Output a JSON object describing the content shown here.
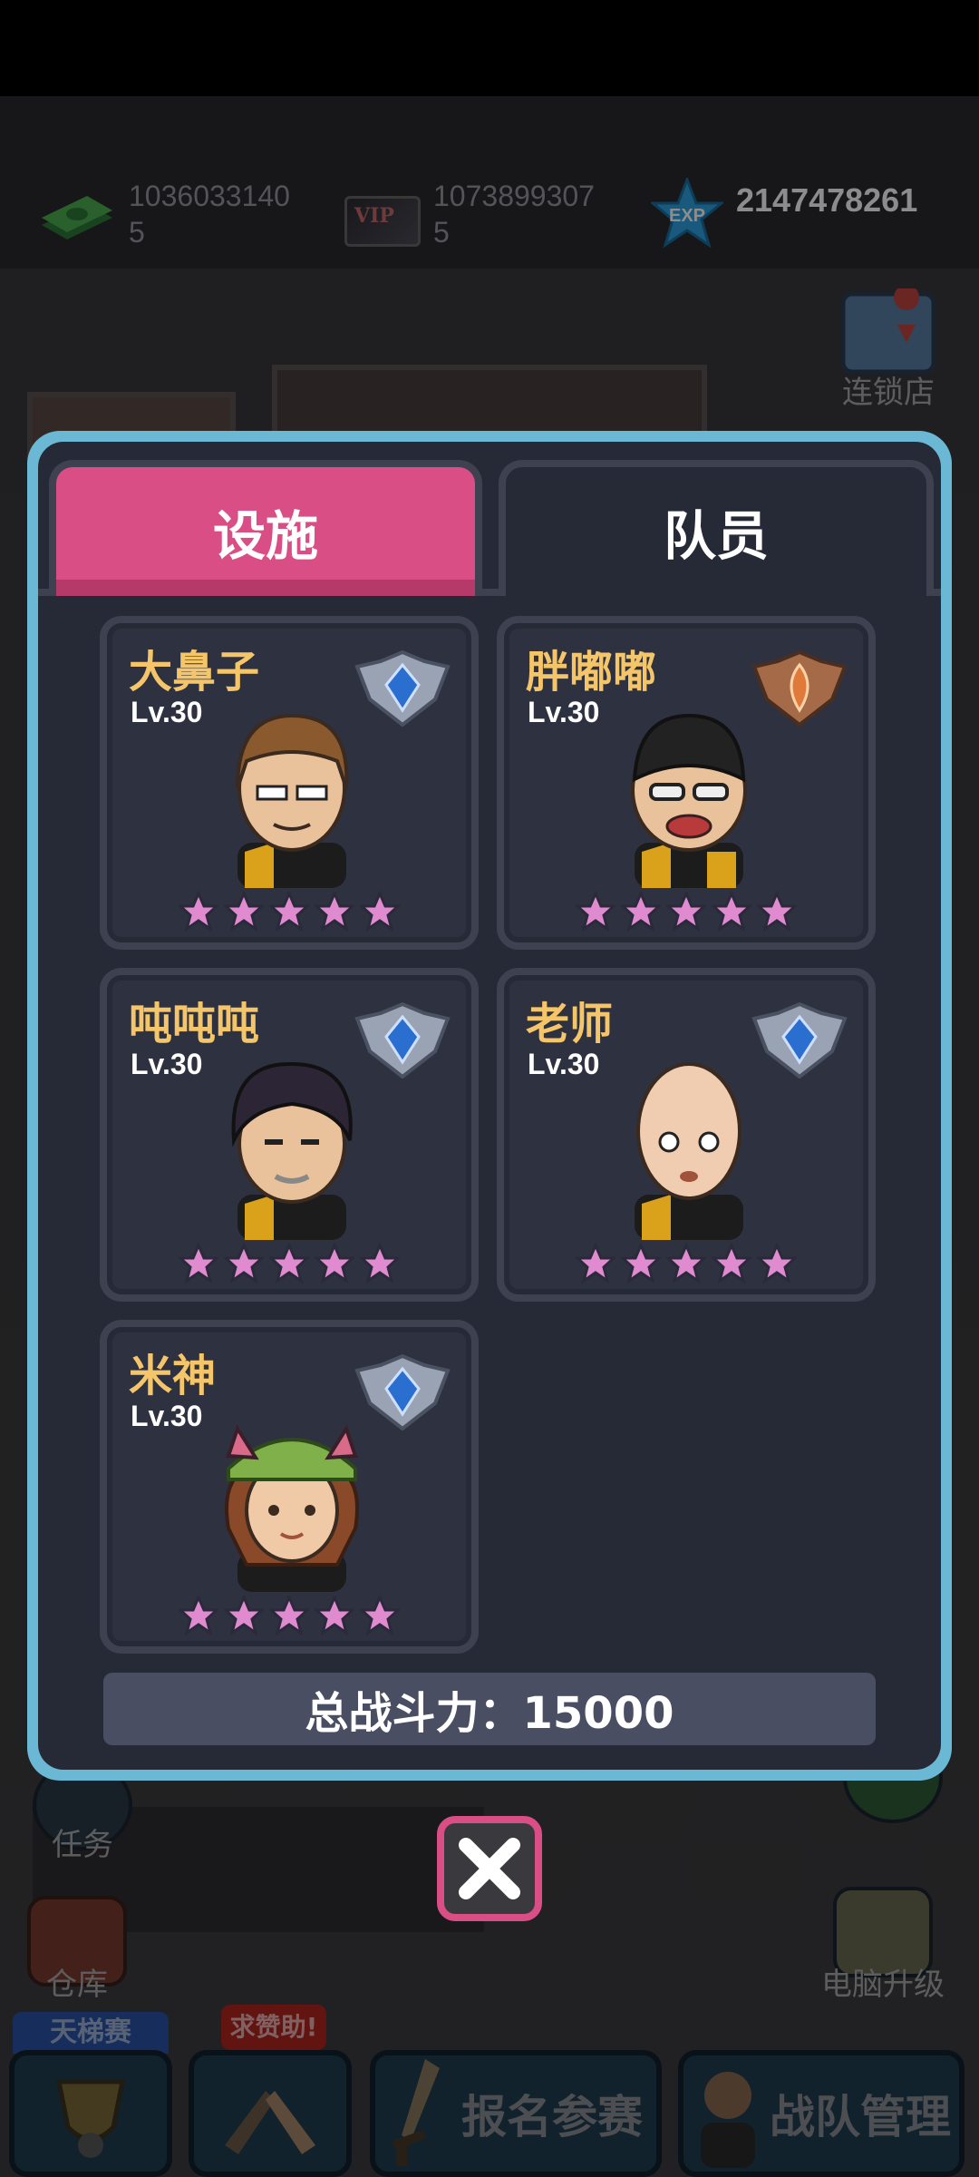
{
  "resources": {
    "cash": "1036033140 5",
    "vip": "1073899307 5",
    "vip_label": "VIP",
    "exp": "2147478261",
    "exp_label": "EXP"
  },
  "background": {
    "chain_store": "连锁店",
    "tasks": "任务",
    "warehouse": "仓库",
    "pc_upgrade": "电脑升级"
  },
  "bottom_nav": {
    "ladder": "天梯赛",
    "help": "求赞助!",
    "signup": "报名参赛",
    "team_manage": "战队管理"
  },
  "modal": {
    "tabs": [
      {
        "label": "设施",
        "active": false
      },
      {
        "label": "队员",
        "active": true
      }
    ],
    "members": [
      {
        "name": "大鼻子",
        "level": "Lv.30",
        "stars": 5,
        "rank": "silver-badge"
      },
      {
        "name": "胖嘟嘟",
        "level": "Lv.30",
        "stars": 5,
        "rank": "bronze-badge"
      },
      {
        "name": "吨吨吨",
        "level": "Lv.30",
        "stars": 5,
        "rank": "silver-badge"
      },
      {
        "name": "老师",
        "level": "Lv.30",
        "stars": 5,
        "rank": "silver-badge"
      },
      {
        "name": "米神",
        "level": "Lv.30",
        "stars": 5,
        "rank": "silver-badge"
      }
    ],
    "total_power": "总战斗力：15000"
  },
  "colors": {
    "accent_pink": "#d94e85",
    "modal_border": "#6bb8d4",
    "name_gold": "#f5c56a",
    "star_pink": "#e08ad0"
  }
}
